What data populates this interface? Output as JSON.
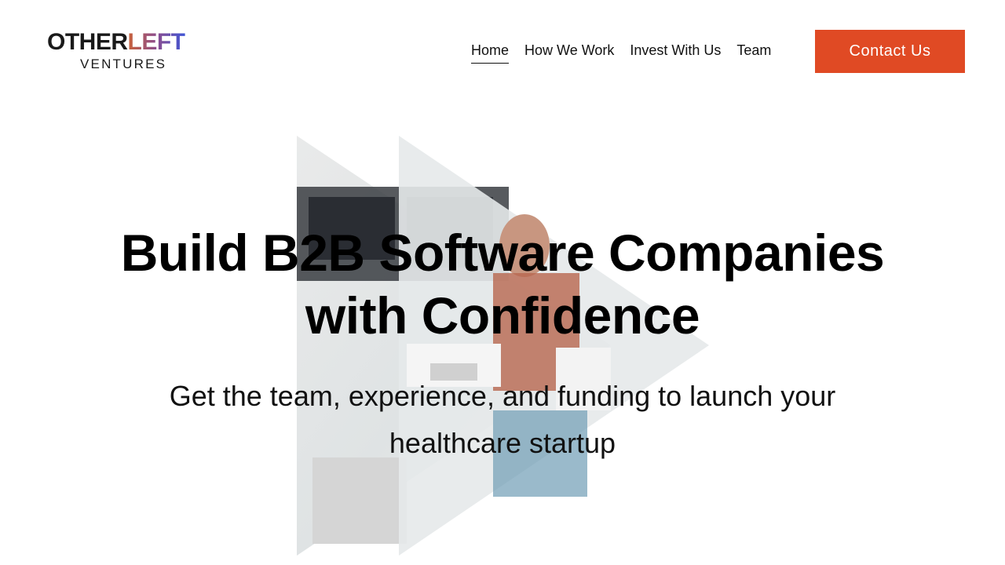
{
  "brand": {
    "logo_top_part1": "OTHER",
    "logo_top_part2": "LEFT",
    "logo_bottom": "VENTURES",
    "accent_color": "#e04a24"
  },
  "nav": {
    "items": [
      {
        "label": "Home",
        "active": true
      },
      {
        "label": "How We Work",
        "active": false
      },
      {
        "label": "Invest With Us",
        "active": false
      },
      {
        "label": "Team",
        "active": false
      }
    ],
    "cta_label": "Contact Us"
  },
  "hero": {
    "title_line1": "Build B2B Software Companies",
    "title_line2": "with Confidence",
    "subtitle_line1": "Get the team, experience, and funding to launch your",
    "subtitle_line2": "healthcare startup"
  }
}
